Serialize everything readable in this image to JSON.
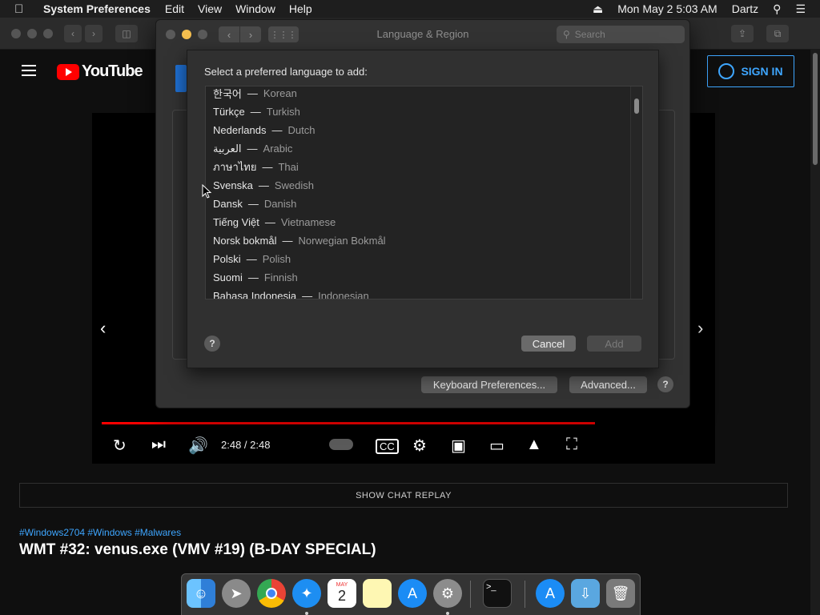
{
  "menubar": {
    "apple_icon": "apple-logo-icon",
    "app_name": "System Preferences",
    "menus": [
      "Edit",
      "View",
      "Window",
      "Help"
    ],
    "datetime": "Mon May 2  5:03 AM",
    "user": "Dartz"
  },
  "youtube": {
    "logo_text": "YouTube",
    "sign_in": "SIGN IN",
    "time": "2:48 / 2:48",
    "progress": 1.0,
    "show_chat_replay": "SHOW CHAT REPLAY",
    "hashtags": "#Windows2704 #Windows #Malwares",
    "title": "WMT #32: venus.exe (VMV #19) (B-DAY SPECIAL)"
  },
  "sysprefs": {
    "title": "Language & Region",
    "search_placeholder": "Search",
    "keyboard_prefs": "Keyboard Preferences...",
    "advanced": "Advanced...",
    "help": "?"
  },
  "sheet": {
    "prompt": "Select a preferred language to add:",
    "languages": [
      {
        "native": "한국어",
        "english": "Korean"
      },
      {
        "native": "Türkçe",
        "english": "Turkish"
      },
      {
        "native": "Nederlands",
        "english": "Dutch"
      },
      {
        "native": "العربية",
        "english": "Arabic"
      },
      {
        "native": "ภาษาไทย",
        "english": "Thai"
      },
      {
        "native": "Svenska",
        "english": "Swedish"
      },
      {
        "native": "Dansk",
        "english": "Danish"
      },
      {
        "native": "Tiếng Việt",
        "english": "Vietnamese"
      },
      {
        "native": "Norsk bokmål",
        "english": "Norwegian Bokmål"
      },
      {
        "native": "Polski",
        "english": "Polish"
      },
      {
        "native": "Suomi",
        "english": "Finnish"
      },
      {
        "native": "Bahasa Indonesia",
        "english": "Indonesian"
      }
    ],
    "dash": "—",
    "help": "?",
    "cancel": "Cancel",
    "add": "Add"
  },
  "dock": {
    "items": [
      "finder-icon",
      "launchpad-icon",
      "chrome-icon",
      "safari-icon",
      "calendar-icon",
      "notes-icon",
      "app-store-icon",
      "system-preferences-icon",
      "terminal-icon",
      "app-store-folder-icon",
      "downloads-folder-icon",
      "trash-icon"
    ],
    "calendar_month": "MAY",
    "calendar_day": "2"
  },
  "colors": {
    "youtube_red": "#ff0000",
    "link_blue": "#3ea6ff"
  }
}
